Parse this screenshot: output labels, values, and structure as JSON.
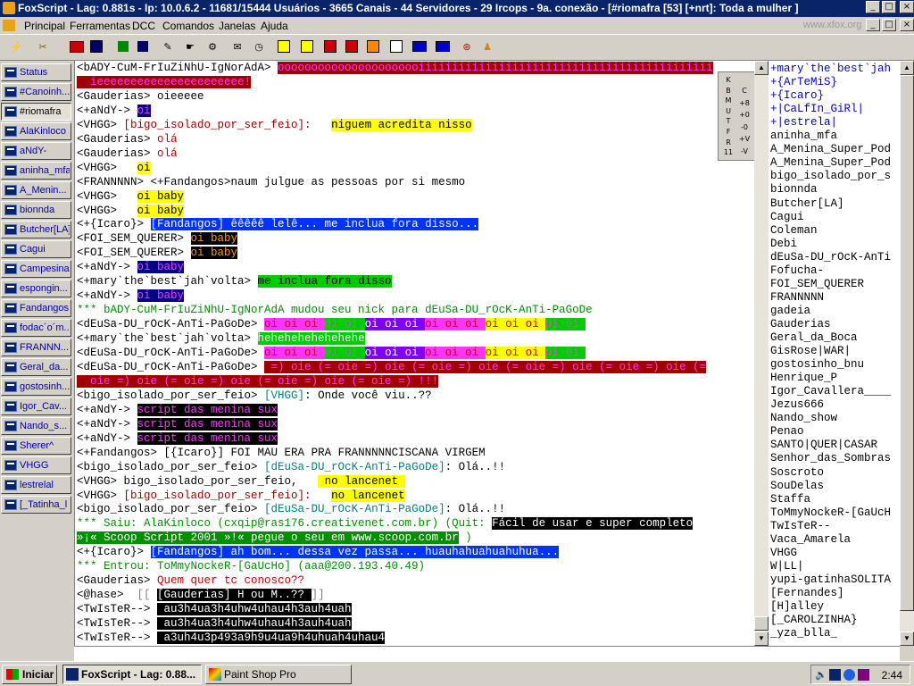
{
  "window": {
    "title": "FoxScript - Lag: 0.881s - Ip: 10.0.6.2 - 11681/15444 Usuários - 3665 Canais - 44 Servidores - 29 Ircops - 9a. conexão - [#riomafra [53] [+nrt]: Toda a mulher ]"
  },
  "menu": {
    "items": [
      "Principal",
      "Ferramentas",
      "DCC",
      "Comandos",
      "Janelas",
      "Ajuda"
    ],
    "watermark": "www.xfox.org"
  },
  "toolbar": {
    "icons": [
      "connect-icon",
      "disconnect-icon",
      "options-icon",
      "channel-list-icon",
      "address-book-icon",
      "scripts-icon",
      "remote-icon",
      "dcc-send-icon",
      "dcc-chat-icon",
      "notify-icon",
      "clock-icon",
      "log-icon",
      "colors-icon",
      "sound-icon",
      "away-icon",
      "icons-icon",
      "fonts-icon",
      "cascade-icon",
      "tile-icon",
      "help-lifebuoy-icon",
      "info-icon"
    ]
  },
  "colors": {
    "chat_bg": "#ffffff",
    "title_bg": "#0a246a",
    "nick_blue": "#0000cc",
    "action_green": "#009000",
    "highlight_yellow": "#ffff00",
    "dark_red": "#a00000"
  },
  "windows": [
    {
      "label": "Status"
    },
    {
      "label": "#Canoinh..."
    },
    {
      "label": "#riomafra"
    },
    {
      "label": "AlaKinloco"
    },
    {
      "label": "aNdY-"
    },
    {
      "label": "aninha_mfa"
    },
    {
      "label": "A_Menin..."
    },
    {
      "label": "bionnda"
    },
    {
      "label": "Butcher[LA]"
    },
    {
      "label": "Cagui"
    },
    {
      "label": "Campesina"
    },
    {
      "label": "espongin..."
    },
    {
      "label": "Fandangos"
    },
    {
      "label": "fodac´o´m..."
    },
    {
      "label": "FRANNN..."
    },
    {
      "label": "Geral_da..."
    },
    {
      "label": "gostosinh..."
    },
    {
      "label": "Igor_Cav..."
    },
    {
      "label": "Nando_s..."
    },
    {
      "label": "Sherer^"
    },
    {
      "label": "VHGG"
    },
    {
      "label": "lestrelal"
    },
    {
      "label": "[_Tatinha_l"
    }
  ],
  "chat": {
    "lines": [
      [
        {
          "t": "<bADY-CuM-FrIuZiNhU-IgNorAdA> ",
          "c": "#000"
        },
        {
          "t": "oooooooooooooooooooooiiiiiiiiiiiiiiiiiiiiiiiiiiiiiiiiiiiiiiiiiiii",
          "c": "#ff33ff",
          "b": "#a00000"
        }
      ],
      [
        {
          "t": "  ieeeeeeeeeeeeeeeeeeeeee!",
          "c": "#ff33ff",
          "b": "#a00000"
        }
      ],
      [
        {
          "t": "<Gauderias> oieeeee",
          "c": "#000"
        }
      ],
      [
        {
          "t": "<+aNdY-> ",
          "c": "#000"
        },
        {
          "t": "oi",
          "c": "#ff33ff",
          "b": "#000080"
        }
      ],
      [
        {
          "t": "<VHGG> ",
          "c": "#000"
        },
        {
          "t": "[bigo_isolado_por_ser_feio]:",
          "c": "#a00000"
        },
        {
          "t": "   ",
          "c": "#000"
        },
        {
          "t": "niguem acredita nisso",
          "c": "#000",
          "b": "#ffff00"
        }
      ],
      [
        {
          "t": "<Gauderias> ",
          "c": "#000"
        },
        {
          "t": "olá",
          "c": "#cc0000"
        }
      ],
      [
        {
          "t": "<Gauderias> ",
          "c": "#000"
        },
        {
          "t": "olá",
          "c": "#cc0000"
        }
      ],
      [
        {
          "t": "<VHGG>   ",
          "c": "#000"
        },
        {
          "t": "oi",
          "c": "#000",
          "b": "#ffff00"
        }
      ],
      [
        {
          "t": "<FRANNNNN> <+Fandangos>naum julgue as pessoas por si mesmo",
          "c": "#000"
        }
      ],
      [
        {
          "t": "<VHGG>   ",
          "c": "#000"
        },
        {
          "t": "oi baby",
          "c": "#000",
          "b": "#ffff00"
        }
      ],
      [
        {
          "t": "<VHGG>   ",
          "c": "#000"
        },
        {
          "t": "oi baby",
          "c": "#000",
          "b": "#ffff00"
        }
      ],
      [
        {
          "t": "<+{Icaro}> ",
          "c": "#000"
        },
        {
          "t": "[Fandangos] êêêêê lelê... me inclua fora disso...",
          "c": "#ffffff",
          "b": "#0033ff"
        }
      ],
      [
        {
          "t": "<FOI_SEM_QUERER> ",
          "c": "#000"
        },
        {
          "t": "oi baby",
          "c": "#ff9900",
          "b": "#000"
        }
      ],
      [
        {
          "t": "<FOI_SEM_QUERER> ",
          "c": "#000"
        },
        {
          "t": "oi baby",
          "c": "#ff9900",
          "b": "#000"
        }
      ],
      [
        {
          "t": "<+aNdY-> ",
          "c": "#000"
        },
        {
          "t": "oi baby",
          "c": "#ff33ff",
          "b": "#000080"
        }
      ],
      [
        {
          "t": "<+mary`the`best`jah`volta> ",
          "c": "#000"
        },
        {
          "t": "me inclua fora disso",
          "c": "#000",
          "b": "#00cc00"
        }
      ],
      [
        {
          "t": "<+aNdY-> ",
          "c": "#000"
        },
        {
          "t": "oi baby",
          "c": "#ff33ff",
          "b": "#000080"
        }
      ],
      [
        {
          "t": "*** bADY-CuM-FrIuZiNhU-IgNorAdA mudou seu nick para dEuSa-DU_rOcK-AnTi-PaGoDe",
          "c": "#009000"
        }
      ],
      [
        {
          "t": "<dEuSa-DU_rOcK-AnTi-PaGoDe> ",
          "c": "#000"
        },
        {
          "t": "oi oi oi ",
          "c": "#cc0000",
          "b": "#ff33ff"
        },
        {
          "t": "oi oi ",
          "c": "#ff33ff",
          "b": "#00cc00"
        },
        {
          "t": "oi oi oi ",
          "c": "#ffffff",
          "b": "#8000ff"
        },
        {
          "t": "oi oi oi ",
          "c": "#cc0000",
          "b": "#ff33ff"
        },
        {
          "t": "oi oi oi ",
          "c": "#cc0000",
          "b": "#ffff00"
        },
        {
          "t": "oi oi ",
          "c": "#ff33ff",
          "b": "#00cc00"
        }
      ],
      [
        {
          "t": "<+mary`the`best`jah`volta> ",
          "c": "#000"
        },
        {
          "t": "hehehehehehehehe",
          "c": "#ffffff",
          "b": "#00cc00"
        }
      ],
      [
        {
          "t": "<dEuSa-DU_rOcK-AnTi-PaGoDe> ",
          "c": "#000"
        },
        {
          "t": "oi oi oi ",
          "c": "#cc0000",
          "b": "#ff33ff"
        },
        {
          "t": "oi oi ",
          "c": "#ff33ff",
          "b": "#00cc00"
        },
        {
          "t": "oi oi oi ",
          "c": "#ffffff",
          "b": "#8000ff"
        },
        {
          "t": "oi oi oi ",
          "c": "#cc0000",
          "b": "#ff33ff"
        },
        {
          "t": "oi oi oi ",
          "c": "#cc0000",
          "b": "#ffff00"
        },
        {
          "t": "oi oi ",
          "c": "#ff33ff",
          "b": "#00cc00"
        }
      ],
      [
        {
          "t": "<dEuSa-DU_rOcK-AnTi-PaGoDe> ",
          "c": "#000"
        },
        {
          "t": " =) oie (= oie =) oie (= oie =) oie (= oie =) oie (= oie =) oie (=",
          "c": "#ff33ff",
          "b": "#a00000"
        }
      ],
      [
        {
          "t": "  oie =) oie (= oie =) oie (= oie =) oie (= oie =) !!!",
          "c": "#ff33ff",
          "b": "#a00000"
        }
      ],
      [
        {
          "t": "<bigo_isolado_por_ser_feio> ",
          "c": "#000"
        },
        {
          "t": "[VHGG]",
          "c": "#008080"
        },
        {
          "t": ": Onde você viu..??",
          "c": "#000"
        }
      ],
      [
        {
          "t": "<+aNdY-> ",
          "c": "#000"
        },
        {
          "t": "script das menina sux",
          "c": "#ff33ff",
          "b": "#000"
        }
      ],
      [
        {
          "t": "<+aNdY-> ",
          "c": "#000"
        },
        {
          "t": "script das menina sux",
          "c": "#ff33ff",
          "b": "#000"
        }
      ],
      [
        {
          "t": "<+aNdY-> ",
          "c": "#000"
        },
        {
          "t": "script das menina sux",
          "c": "#ff33ff",
          "b": "#000"
        }
      ],
      [
        {
          "t": "<+Fandangos> ",
          "c": "#000"
        },
        {
          "t": "[{Icaro}]",
          "c": "#000"
        },
        {
          "t": " FOI MAU ERA PRA FRANNNNNCISCANA VIRGEM",
          "c": "#000"
        }
      ],
      [
        {
          "t": "<bigo_isolado_por_ser_feio> ",
          "c": "#000"
        },
        {
          "t": "[dEuSa-DU_rOcK-AnTi-PaGoDe]",
          "c": "#008080"
        },
        {
          "t": ": Olá..!!",
          "c": "#000"
        }
      ],
      [
        {
          "t": "<VHGG> ",
          "c": "#000"
        },
        {
          "t": "bigo_isolado_por_ser_feio",
          "c": "#000"
        },
        {
          "t": ",   ",
          "c": "#000"
        },
        {
          "t": " no lancenet ",
          "c": "#000",
          "b": "#ffff00"
        }
      ],
      [
        {
          "t": "<VHGG> ",
          "c": "#000"
        },
        {
          "t": "[bigo_isolado_por_ser_feio]:",
          "c": "#a00000"
        },
        {
          "t": "   ",
          "c": "#000"
        },
        {
          "t": "no lancenet",
          "c": "#000",
          "b": "#ffff00"
        }
      ],
      [
        {
          "t": "<bigo_isolado_por_ser_feio> ",
          "c": "#000"
        },
        {
          "t": "[dEuSa-DU_rOcK-AnTi-PaGoDe]",
          "c": "#008080"
        },
        {
          "t": ": Olá..!!",
          "c": "#000"
        }
      ],
      [
        {
          "t": "*** Saiu: AlaKinloco (cxqip@ras176.creativenet.com.br) (Quit: ",
          "c": "#009000"
        },
        {
          "t": "Fácil de usar e super completo",
          "c": "#ffffff",
          "b": "#000"
        },
        {
          "t": " ",
          "c": "#000"
        }
      ],
      [
        {
          "t": "»¡« Scoop Script 2001 »!« ",
          "c": "#ffffff",
          "b": "#009000"
        },
        {
          "t": "pegue o seu em ",
          "c": "#ffffff",
          "b": "#009000"
        },
        {
          "t": "www.scoop.com.br",
          "c": "#ffffff",
          "b": "#009000"
        },
        {
          "t": " )",
          "c": "#009000"
        }
      ],
      [
        {
          "t": "<+{Icaro}> ",
          "c": "#000"
        },
        {
          "t": "[Fandangos] ah bom... dessa vez passa... huauhahuahuahuhua...",
          "c": "#ffffff",
          "b": "#0033ff"
        }
      ],
      [
        {
          "t": "*** Entrou: ToMmyNockeR-[GaUcHo] (aaa@200.193.40.49)",
          "c": "#009000"
        }
      ],
      [
        {
          "t": "<Gauderias> ",
          "c": "#000"
        },
        {
          "t": "Quem quer tc conosco??",
          "c": "#cc0000"
        }
      ],
      [
        {
          "t": "<@hase> ",
          "c": "#000"
        },
        {
          "t": " [[ ",
          "c": "#808080",
          "b": "#fff"
        },
        {
          "t": "[Gauderias]",
          "c": "#ffffff",
          "b": "#000"
        },
        {
          "t": " H ou M..?? ",
          "c": "#ffffff",
          "b": "#000"
        },
        {
          "t": "]]",
          "c": "#808080",
          "b": "#fff"
        }
      ],
      [
        {
          "t": "<TwIsTeR--> ",
          "c": "#000"
        },
        {
          "t": " au3h4ua3h4uhw4uhau4h3auh4uah",
          "c": "#ffffff",
          "b": "#000"
        }
      ],
      [
        {
          "t": "<TwIsTeR--> ",
          "c": "#000"
        },
        {
          "t": " au3h4ua3h4uhw4uhau4h3auh4uah",
          "c": "#ffffff",
          "b": "#000"
        }
      ],
      [
        {
          "t": "<TwIsTeR--> ",
          "c": "#000"
        },
        {
          "t": " a3uh4u3p493a9h9u4ua9h4uhuah4uhau4",
          "c": "#ffffff",
          "b": "#000"
        }
      ]
    ]
  },
  "controls": {
    "buttons": [
      "K",
      "B",
      "M",
      "U",
      "T",
      "F",
      "R",
      "11"
    ],
    "buttons_right": [
      "C",
      "+8",
      "+0",
      "-0",
      "+V",
      "-V"
    ]
  },
  "nicklist": {
    "nicks": [
      {
        "n": "+mary`the`best`jah",
        "op": true
      },
      {
        "n": "+{ArTeMiS}",
        "op": true
      },
      {
        "n": "+{Icaro}",
        "op": true
      },
      {
        "n": "+|CaLfIn_GiRl|",
        "op": true
      },
      {
        "n": "+|estrela|",
        "op": true
      },
      {
        "n": "aninha_mfa",
        "op": false
      },
      {
        "n": "A_Menina_Super_Pod",
        "op": false
      },
      {
        "n": "A_Menina_Super_Pod",
        "op": false
      },
      {
        "n": "bigo_isolado_por_s",
        "op": false
      },
      {
        "n": "bionnda",
        "op": false
      },
      {
        "n": "Butcher[LA]",
        "op": false
      },
      {
        "n": "Cagui",
        "op": false
      },
      {
        "n": "Coleman",
        "op": false
      },
      {
        "n": "Debi",
        "op": false
      },
      {
        "n": "dEuSa-DU_rOcK-AnTi",
        "op": false
      },
      {
        "n": "Fofucha-",
        "op": false
      },
      {
        "n": "FOI_SEM_QUERER",
        "op": false
      },
      {
        "n": "FRANNNNN",
        "op": false
      },
      {
        "n": "gadeia",
        "op": false
      },
      {
        "n": "Gauderias",
        "op": false
      },
      {
        "n": "Geral_da_Boca",
        "op": false
      },
      {
        "n": "GisRose|WAR|",
        "op": false
      },
      {
        "n": "gostosinho_bnu",
        "op": false
      },
      {
        "n": "Henrique_P",
        "op": false
      },
      {
        "n": "Igor_Cavallera____",
        "op": false
      },
      {
        "n": "Jezus666",
        "op": false
      },
      {
        "n": "Nando_show",
        "op": false
      },
      {
        "n": "Penao",
        "op": false
      },
      {
        "n": "SANTO|QUER|CASAR",
        "op": false
      },
      {
        "n": "Senhor_das_Sombras",
        "op": false
      },
      {
        "n": "Soscroto",
        "op": false
      },
      {
        "n": "SouDelas",
        "op": false
      },
      {
        "n": "Staffa",
        "op": false
      },
      {
        "n": "ToMmyNockeR-[GaUcH",
        "op": false
      },
      {
        "n": "TwIsTeR--",
        "op": false
      },
      {
        "n": "Vaca_Amarela",
        "op": false
      },
      {
        "n": "VHGG",
        "op": false
      },
      {
        "n": "W|LL|",
        "op": false
      },
      {
        "n": "yupi-gatinhaSOLITA",
        "op": false
      },
      {
        "n": "[Fernandes]",
        "op": false
      },
      {
        "n": "[H]alley",
        "op": false
      },
      {
        "n": "[_CAROLZINHA}",
        "op": false
      },
      {
        "n": "_yza_blla_",
        "op": false
      }
    ]
  },
  "taskbar": {
    "start": "Iniciar",
    "tasks": [
      "FoxScript - Lag: 0.88...",
      "Paint Shop Pro"
    ],
    "clock": "2:44"
  }
}
